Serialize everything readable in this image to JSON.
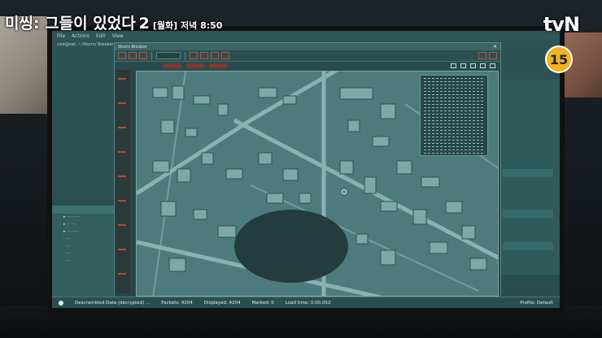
{
  "broadcast": {
    "show_title": "미씽: 그들이 있었다",
    "season": "2",
    "schedule": "[월화] 저녁 8:50",
    "network": "tvN",
    "age_rating": "15"
  },
  "os_window": {
    "menu": [
      "File",
      "Actions",
      "Edit",
      "View"
    ],
    "address": "root@sat: ~/Storm/ Breaker",
    "status": {
      "message": "Descrambled Data (decrypted) ...",
      "packets": "Packets: 4204",
      "displayed": "Displayed: 4204",
      "marked": "Marked: 0",
      "load_time": "Load time: 0:00.052",
      "profile": "Profile: Default"
    }
  },
  "app_window": {
    "title": "Storm Breaker",
    "toolbar_field": "filter"
  },
  "colors": {
    "screen_tint": "#2d5354",
    "accent_red": "#b14a3c",
    "rating_badge": "#f0b323"
  }
}
